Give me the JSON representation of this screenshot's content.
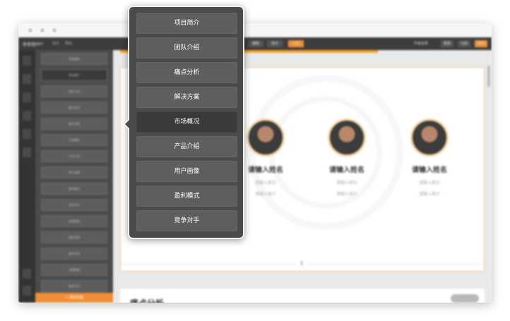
{
  "window": {
    "logo": "鱼骨图PPT",
    "menus": [
      "设计",
      "导出"
    ],
    "mode_tabs": [
      "编辑",
      "演示",
      "分享"
    ],
    "right_buttons": [
      "登录",
      "注册",
      "保存"
    ],
    "badge": "升级会员"
  },
  "slide_panel": {
    "items": [
      "封面模板",
      "项目简介",
      "团队介绍",
      "痛点分析",
      "解决方案",
      "市场概况",
      "产品介绍",
      "用户画像",
      "盈利模式",
      "竞争对手",
      "发展规划",
      "财务预测",
      "融资计划",
      "运营数据",
      "联系方式",
      "感谢观看"
    ],
    "add_label": "+ 添加页面"
  },
  "team": {
    "members": [
      {
        "name": "请输入姓名",
        "role": "请输入职位",
        "desc": "请输入简介"
      },
      {
        "name": "请输入姓名",
        "role": "请输入职位",
        "desc": "请输入简介"
      },
      {
        "name": "请输入姓名",
        "role": "请输入职位",
        "desc": "请输入简介"
      }
    ]
  },
  "next_slide": {
    "title": "痛点分析"
  },
  "popup_menu": {
    "items": [
      "项目简介",
      "团队介绍",
      "痛点分析",
      "解决方案",
      "市场概况",
      "产品介绍",
      "用户画像",
      "盈利模式",
      "竞争对手"
    ],
    "active_index": 4
  },
  "colors": {
    "accent": "#f08f37",
    "popup_bg": "#4b4b4b",
    "menu_item": "#5e5e5e",
    "menu_item_active": "#3a3a3a"
  }
}
